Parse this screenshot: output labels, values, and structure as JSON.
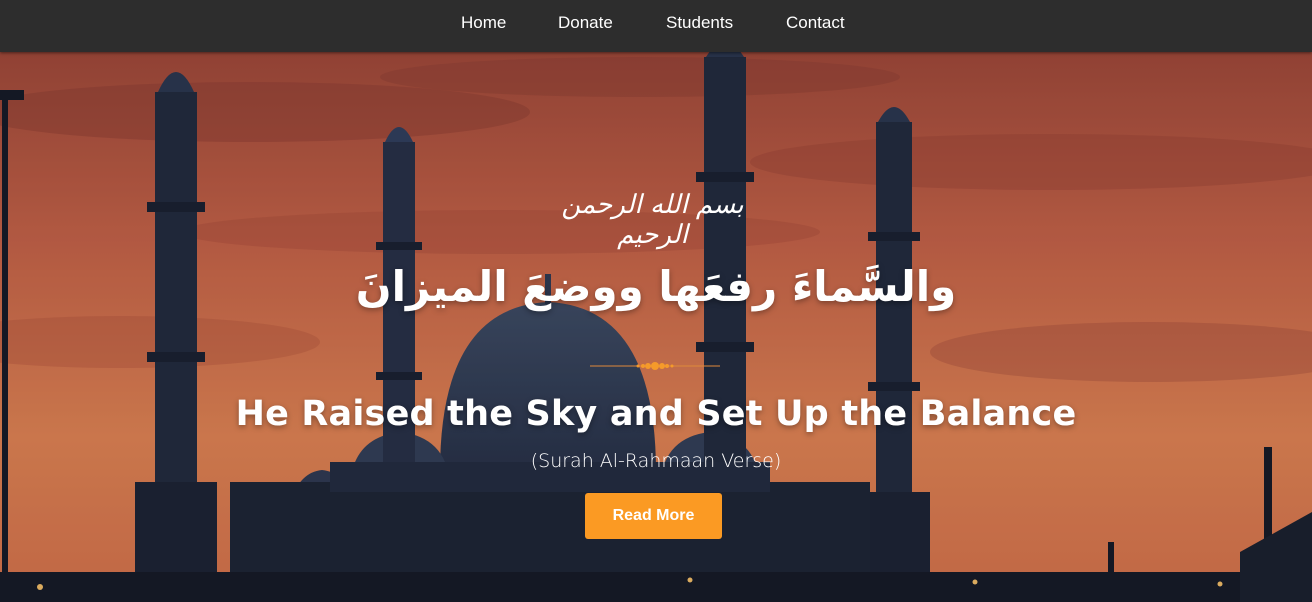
{
  "nav": {
    "items": [
      {
        "label": "Home"
      },
      {
        "label": "Donate"
      },
      {
        "label": "Students"
      },
      {
        "label": "Contact"
      }
    ]
  },
  "hero": {
    "bismillah": "بسم الله الرحمن الرحيم",
    "arabic_verse": "والسَّماءَ رفعَها ووضعَ الميزانَ",
    "title": "He Raised the Sky and Set Up the Balance",
    "subtitle": "(Surah Al-Rahmaan Verse)",
    "cta_label": "Read More"
  },
  "colors": {
    "navbar": "#2d2d2d",
    "accent": "#fb9a23",
    "sky_top": "#b0503f",
    "sky_bottom": "#e9895f",
    "silhouette": "#1d2637"
  }
}
